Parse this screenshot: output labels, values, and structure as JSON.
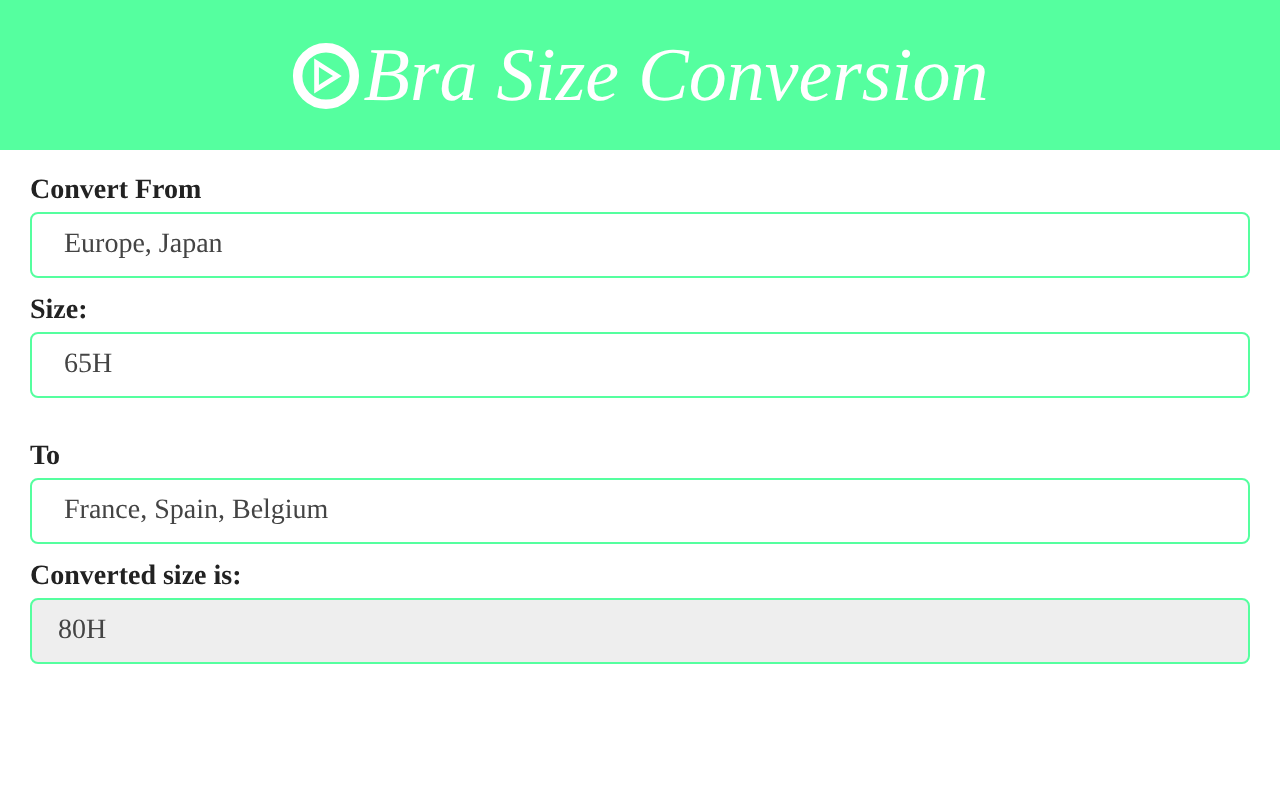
{
  "header": {
    "title": "Bra Size Conversion"
  },
  "groups": [
    {
      "fields": [
        {
          "label": "Convert From",
          "value": "Europe, Japan",
          "kind": "select"
        },
        {
          "label": "Size:",
          "value": "65H",
          "kind": "text"
        }
      ]
    },
    {
      "fields": [
        {
          "label": "To",
          "value": "France, Spain, Belgium",
          "kind": "select"
        },
        {
          "label": "Converted size is:",
          "value": "80H",
          "kind": "readonly"
        }
      ]
    }
  ]
}
